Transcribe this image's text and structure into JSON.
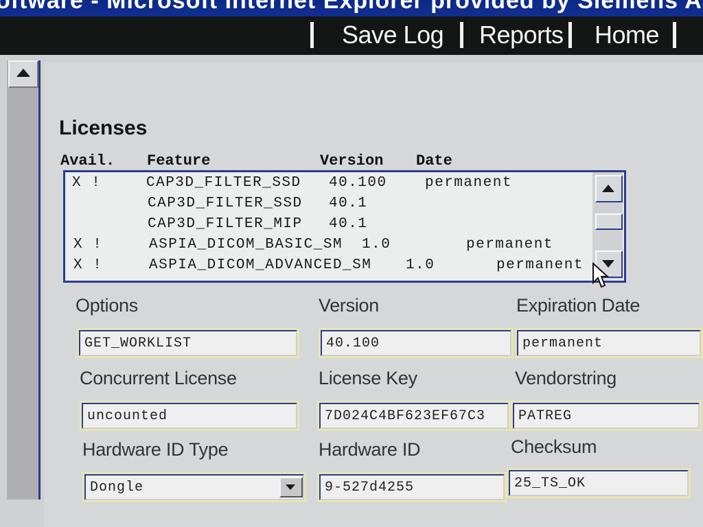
{
  "window": {
    "title": "oftware - Microsoft Internet Explorer provided by Siemens AG ..."
  },
  "nav": {
    "links": [
      "Save Log",
      "Reports",
      "Home"
    ]
  },
  "licenses": {
    "heading": "Licenses",
    "columns": {
      "avail": "Avail.",
      "feature": "Feature",
      "version": "Version",
      "date": "Date"
    },
    "rows": [
      {
        "avail": "X !",
        "feature": "CAP3D_FILTER_SSD",
        "version": "40.100",
        "date": "permanent"
      },
      {
        "avail": "",
        "feature": "CAP3D_FILTER_SSD",
        "version": "40.1",
        "date": ""
      },
      {
        "avail": "",
        "feature": "CAP3D_FILTER_MIP",
        "version": "40.1",
        "date": ""
      },
      {
        "avail": "X !",
        "feature": "ASPIA_DICOM_BASIC_SM",
        "version": "1.0",
        "date": "permanent"
      },
      {
        "avail": "X !",
        "feature": "ASPIA_DICOM_ADVANCED_SM",
        "version": "1.0",
        "date": "permanent"
      }
    ]
  },
  "form": {
    "options": {
      "label": "Options",
      "value": "GET_WORKLIST"
    },
    "version": {
      "label": "Version",
      "value": "40.100"
    },
    "expiration": {
      "label": "Expiration Date",
      "value": "permanent"
    },
    "concurrent": {
      "label": "Concurrent License",
      "value": "uncounted"
    },
    "license_key": {
      "label": "License Key",
      "value": "7D024C4BF623EF67C3"
    },
    "vendor": {
      "label": "Vendorstring",
      "value": "PATREG"
    },
    "hwid_type": {
      "label": "Hardware ID Type",
      "value": "Dongle"
    },
    "hwid": {
      "label": "Hardware ID",
      "value": "9-527d4255"
    },
    "checksum": {
      "label": "Checksum",
      "value": "25_TS_OK"
    }
  }
}
